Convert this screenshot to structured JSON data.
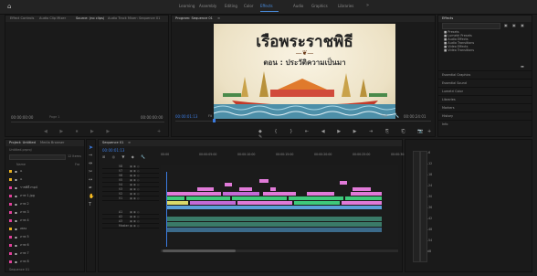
{
  "topbar": {
    "home_icon": "home-icon",
    "workspaces": [
      "Learning",
      "Assembly",
      "Editing",
      "Color",
      "Effects",
      "Audio",
      "Graphics",
      "Libraries"
    ],
    "more": "»"
  },
  "source_panel": {
    "tabs": [
      "Effect Controls",
      "Audio Clip Mixer",
      "Source: (no clips)",
      "Audio Track Mixer: Sequence 01"
    ],
    "left_tc": "00:00:00:00",
    "right_tc": "00:00:00:00",
    "page": "Page 1"
  },
  "program_panel": {
    "tab": "Program: Sequence 01",
    "menu": "≡",
    "title_text": "เรือพระราชพิธี",
    "subtitle_text": "ตอน : ประวัติความเป็นมา",
    "timecode": "00:00:01:13",
    "fit": "Fit",
    "zoom": "Full",
    "duration": "00:00:24:01"
  },
  "project_panel": {
    "tabs": [
      "Project: Untitled",
      "Media Browser"
    ],
    "file": "Untitled.prproj",
    "count": "12 Items",
    "name_header": "Name",
    "rate_header": "Fra",
    "items": [
      {
        "name": "ฉ",
        "color": "#e8b020"
      },
      {
        "name": "ฉ",
        "color": "#e8b020"
      },
      {
        "name": "ราชพิธี.mp4",
        "color": "#e0409a"
      },
      {
        "name": "ภาพ 1.jpg",
        "color": "#e0409a"
      },
      {
        "name": "ภาพ 2",
        "color": "#e0409a"
      },
      {
        "name": "ภาพ 3",
        "color": "#e0409a"
      },
      {
        "name": "ภาพ 4",
        "color": "#e0409a"
      },
      {
        "name": "เพลง",
        "color": "#e8b020"
      },
      {
        "name": "ภาพ 5",
        "color": "#e0409a"
      },
      {
        "name": "ภาพ 6",
        "color": "#e0409a"
      },
      {
        "name": "ภาพ 7",
        "color": "#e0409a"
      },
      {
        "name": "ภาพ 8",
        "color": "#e0409a"
      }
    ],
    "footer": "Sequence 01"
  },
  "timeline_panel": {
    "tab": "Sequence 01",
    "menu": "≡",
    "timecode": "00:00:01:13",
    "ruler": [
      "00:00",
      "00:00:05:00",
      "00:00:10:00",
      "00:00:15:00",
      "00:00:20:00",
      "00:00:25:00",
      "00:00:30:00"
    ],
    "tracks": [
      "V8",
      "V7",
      "V6",
      "V5",
      "V4",
      "V3",
      "V2",
      "V1",
      "A1",
      "A2",
      "A3",
      "Master"
    ],
    "master_value": "0.0"
  },
  "effects_panel": {
    "tab": "Effects",
    "search_placeholder": "",
    "folders": [
      "Presets",
      "Lumetri Presets",
      "Audio Effects",
      "Audio Transitions",
      "Video Effects",
      "Video Transitions"
    ],
    "sections": [
      "Essential Graphics",
      "Essential Sound",
      "Lumetri Color",
      "Libraries",
      "Markers",
      "History",
      "Info"
    ]
  },
  "status": {
    "meter_labels": [
      "-6",
      "-12",
      "-18",
      "-24",
      "-30",
      "-36",
      "-42",
      "-48",
      "-54",
      "dB"
    ]
  }
}
